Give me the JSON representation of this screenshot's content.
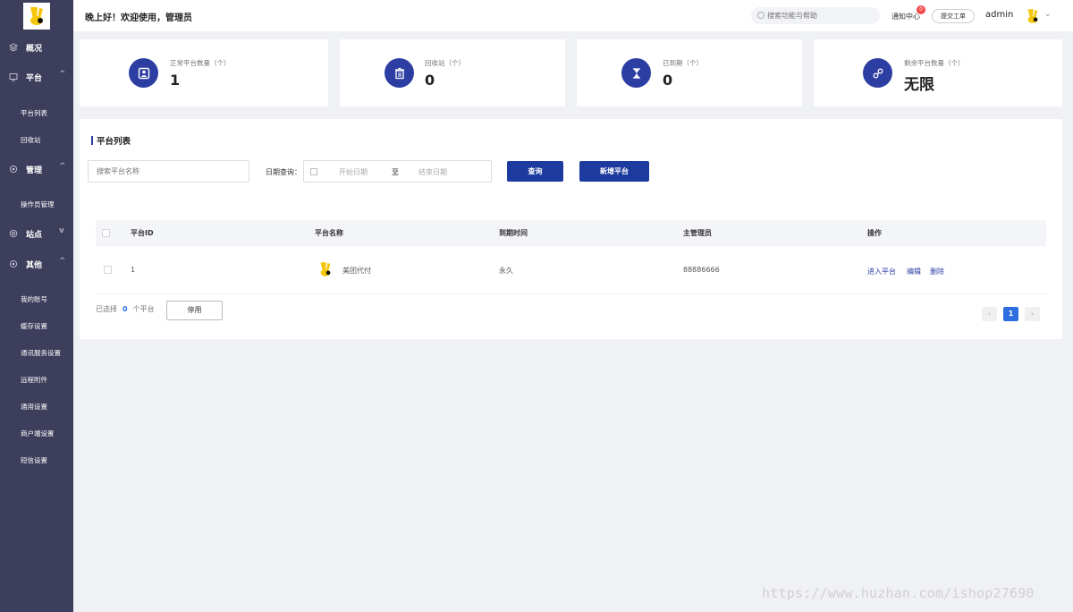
{
  "sidebar": {
    "groups": [
      {
        "label": "概况",
        "icon": "layers-icon",
        "chevron": ""
      },
      {
        "label": "平台",
        "icon": "monitor-icon",
        "chevron": "^"
      },
      {
        "label": "管理",
        "icon": "gear-icon",
        "chevron": "^"
      },
      {
        "label": "站点",
        "icon": "globe-icon",
        "chevron": "v"
      },
      {
        "label": "其他",
        "icon": "gear-icon",
        "chevron": "^"
      }
    ],
    "subitems": [
      "平台列表",
      "回收站",
      "操作员管理",
      "我的账号",
      "缓存设置",
      "通讯服务设置",
      "远程附件",
      "通用设置",
      "商户端设置",
      "短信设置"
    ]
  },
  "header": {
    "greeting": "晚上好！欢迎使用，管理员",
    "search_placeholder": "搜索功能与帮助",
    "notification_label": "通知中心",
    "notification_count": "0",
    "ticket_label": "提交工单",
    "user_name": "admin"
  },
  "stats": [
    {
      "title": "正常平台数量（个）",
      "value": "1",
      "icon": "user-card-icon"
    },
    {
      "title": "回收站（个）",
      "value": "0",
      "icon": "trash-icon"
    },
    {
      "title": "已到期（个）",
      "value": "0",
      "icon": "hourglass-icon"
    },
    {
      "title": "剩余平台数量（个）",
      "value": "无限",
      "icon": "link-icon"
    }
  ],
  "panel": {
    "title": "平台列表",
    "name_placeholder": "搜索平台名称",
    "date_label": "日期查询：",
    "date_start": "开始日期",
    "date_to": "至",
    "date_end": "结束日期",
    "query_button": "查询",
    "add_button": "新增平台"
  },
  "table": {
    "columns": [
      "平台ID",
      "平台名称",
      "到期时间",
      "主管理员",
      "操作"
    ],
    "rows": [
      {
        "id": "1",
        "name": "美团代付",
        "expire": "永久",
        "admin": "88886666",
        "actions": [
          "进入平台",
          "编辑",
          "删除"
        ]
      }
    ]
  },
  "footer": {
    "selected_prefix": "已选择",
    "selected_count": "0",
    "selected_suffix": "个平台",
    "disable_button": "停用",
    "pagination": {
      "prev": "‹",
      "current": "1",
      "next": "›"
    }
  },
  "watermark": "https://www.huzhan.com/ishop27690",
  "colors": {
    "sidebar": "#3d3d5c",
    "primary": "#1d3a9e",
    "accent": "#2d6fe0",
    "badge": "#f04848"
  }
}
